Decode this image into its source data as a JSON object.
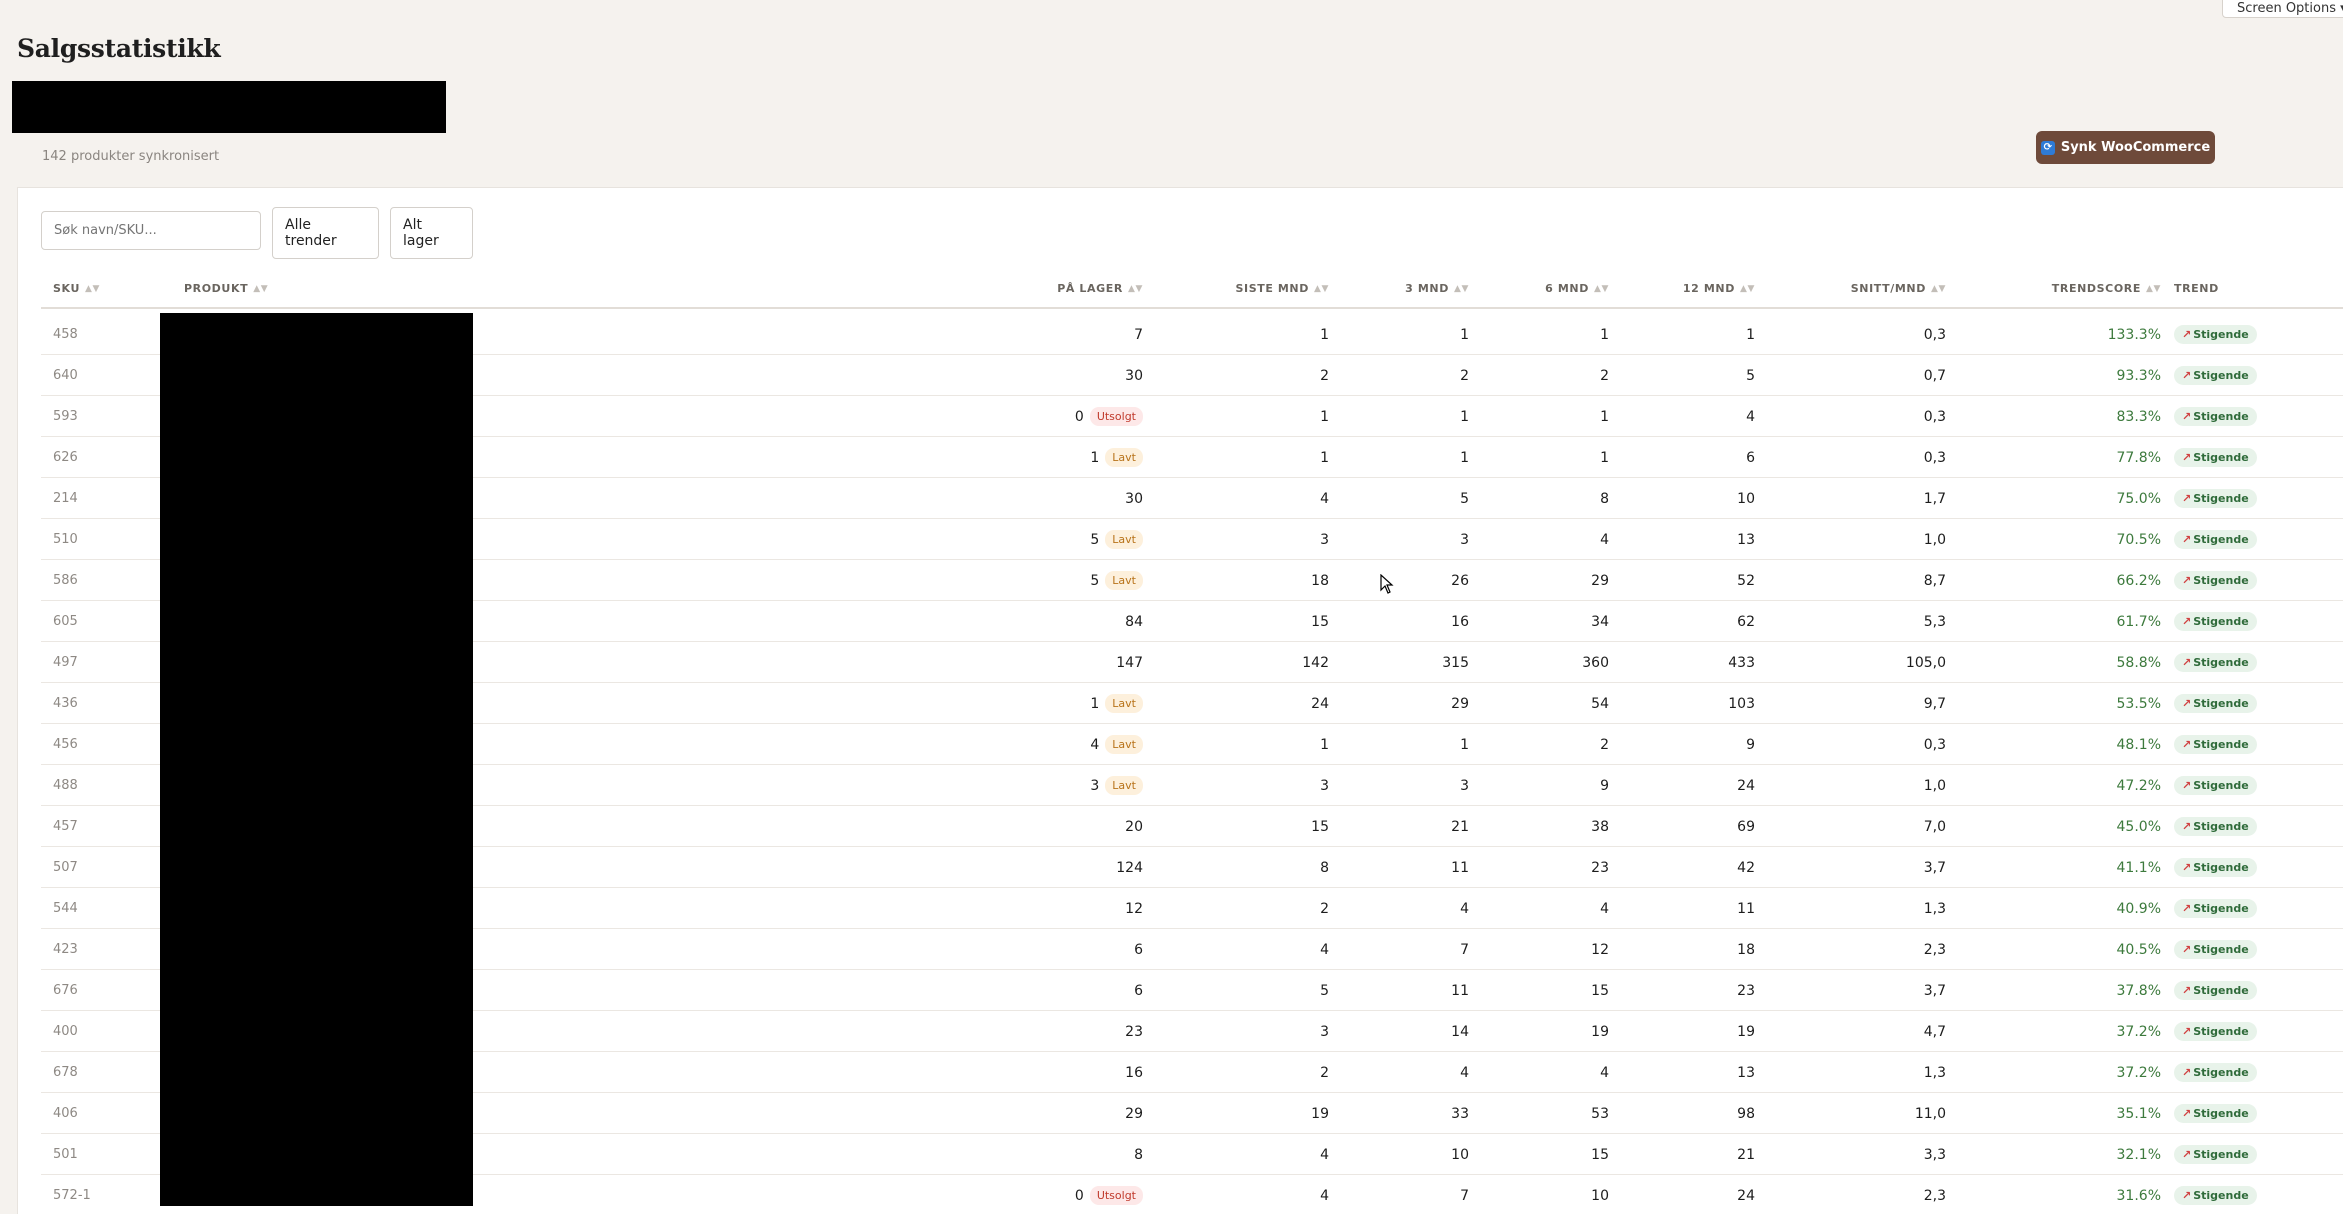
{
  "screen_options": "Screen Options ▾",
  "page": {
    "title": "Salgsstatistikk",
    "sync_count": "142 produkter synkronisert",
    "sync_button": "Synk WooCommerce"
  },
  "filters": {
    "search_placeholder": "Søk navn/SKU...",
    "trend_select": "Alle trender",
    "stock_select": "Alt lager"
  },
  "table": {
    "headers": {
      "sku": "SKU",
      "product": "PRODUKT",
      "stock": "PÅ LAGER",
      "last_month": "SISTE MND",
      "m3": "3 MND",
      "m6": "6 MND",
      "m12": "12 MND",
      "avg": "SNITT/MND",
      "score": "TRENDSCORE",
      "trend": "TREND"
    },
    "rows": [
      {
        "sku": "458",
        "stock": "7",
        "badge": "",
        "last": "1",
        "m3": "1",
        "m6": "1",
        "m12": "1",
        "avg": "0,3",
        "score": "133.3%",
        "trend": "Stigende"
      },
      {
        "sku": "640",
        "stock": "30",
        "badge": "",
        "last": "2",
        "m3": "2",
        "m6": "2",
        "m12": "5",
        "avg": "0,7",
        "score": "93.3%",
        "trend": "Stigende"
      },
      {
        "sku": "593",
        "stock": "0",
        "badge": "Utsolgt",
        "last": "1",
        "m3": "1",
        "m6": "1",
        "m12": "4",
        "avg": "0,3",
        "score": "83.3%",
        "trend": "Stigende"
      },
      {
        "sku": "626",
        "stock": "1",
        "badge": "Lavt",
        "last": "1",
        "m3": "1",
        "m6": "1",
        "m12": "6",
        "avg": "0,3",
        "score": "77.8%",
        "trend": "Stigende"
      },
      {
        "sku": "214",
        "stock": "30",
        "badge": "",
        "last": "4",
        "m3": "5",
        "m6": "8",
        "m12": "10",
        "avg": "1,7",
        "score": "75.0%",
        "trend": "Stigende"
      },
      {
        "sku": "510",
        "stock": "5",
        "badge": "Lavt",
        "last": "3",
        "m3": "3",
        "m6": "4",
        "m12": "13",
        "avg": "1,0",
        "score": "70.5%",
        "trend": "Stigende"
      },
      {
        "sku": "586",
        "stock": "5",
        "badge": "Lavt",
        "last": "18",
        "m3": "26",
        "m6": "29",
        "m12": "52",
        "avg": "8,7",
        "score": "66.2%",
        "trend": "Stigende"
      },
      {
        "sku": "605",
        "stock": "84",
        "badge": "",
        "last": "15",
        "m3": "16",
        "m6": "34",
        "m12": "62",
        "avg": "5,3",
        "score": "61.7%",
        "trend": "Stigende"
      },
      {
        "sku": "497",
        "stock": "147",
        "badge": "",
        "last": "142",
        "m3": "315",
        "m6": "360",
        "m12": "433",
        "avg": "105,0",
        "score": "58.8%",
        "trend": "Stigende"
      },
      {
        "sku": "436",
        "stock": "1",
        "badge": "Lavt",
        "last": "24",
        "m3": "29",
        "m6": "54",
        "m12": "103",
        "avg": "9,7",
        "score": "53.5%",
        "trend": "Stigende"
      },
      {
        "sku": "456",
        "stock": "4",
        "badge": "Lavt",
        "last": "1",
        "m3": "1",
        "m6": "2",
        "m12": "9",
        "avg": "0,3",
        "score": "48.1%",
        "trend": "Stigende"
      },
      {
        "sku": "488",
        "stock": "3",
        "badge": "Lavt",
        "last": "3",
        "m3": "3",
        "m6": "9",
        "m12": "24",
        "avg": "1,0",
        "score": "47.2%",
        "trend": "Stigende"
      },
      {
        "sku": "457",
        "stock": "20",
        "badge": "",
        "last": "15",
        "m3": "21",
        "m6": "38",
        "m12": "69",
        "avg": "7,0",
        "score": "45.0%",
        "trend": "Stigende"
      },
      {
        "sku": "507",
        "stock": "124",
        "badge": "",
        "last": "8",
        "m3": "11",
        "m6": "23",
        "m12": "42",
        "avg": "3,7",
        "score": "41.1%",
        "trend": "Stigende"
      },
      {
        "sku": "544",
        "stock": "12",
        "badge": "",
        "last": "2",
        "m3": "4",
        "m6": "4",
        "m12": "11",
        "avg": "1,3",
        "score": "40.9%",
        "trend": "Stigende"
      },
      {
        "sku": "423",
        "stock": "6",
        "badge": "",
        "last": "4",
        "m3": "7",
        "m6": "12",
        "m12": "18",
        "avg": "2,3",
        "score": "40.5%",
        "trend": "Stigende"
      },
      {
        "sku": "676",
        "stock": "6",
        "badge": "",
        "last": "5",
        "m3": "11",
        "m6": "15",
        "m12": "23",
        "avg": "3,7",
        "score": "37.8%",
        "trend": "Stigende"
      },
      {
        "sku": "400",
        "stock": "23",
        "badge": "",
        "last": "3",
        "m3": "14",
        "m6": "19",
        "m12": "19",
        "avg": "4,7",
        "score": "37.2%",
        "trend": "Stigende"
      },
      {
        "sku": "678",
        "stock": "16",
        "badge": "",
        "last": "2",
        "m3": "4",
        "m6": "4",
        "m12": "13",
        "avg": "1,3",
        "score": "37.2%",
        "trend": "Stigende"
      },
      {
        "sku": "406",
        "stock": "29",
        "badge": "",
        "last": "19",
        "m3": "33",
        "m6": "53",
        "m12": "98",
        "avg": "11,0",
        "score": "35.1%",
        "trend": "Stigende"
      },
      {
        "sku": "501",
        "stock": "8",
        "badge": "",
        "last": "4",
        "m3": "10",
        "m6": "15",
        "m12": "21",
        "avg": "3,3",
        "score": "32.1%",
        "trend": "Stigende"
      },
      {
        "sku": "572-1",
        "stock": "0",
        "badge": "Utsolgt",
        "last": "4",
        "m3": "7",
        "m6": "10",
        "m12": "24",
        "avg": "2,3",
        "score": "31.6%",
        "trend": "Stigende"
      }
    ]
  }
}
